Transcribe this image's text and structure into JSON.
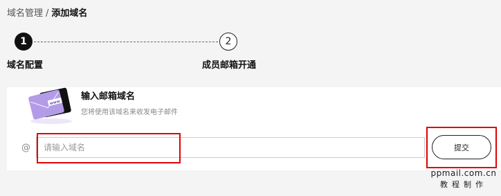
{
  "breadcrumb": {
    "parent": "域名管理",
    "separator": "/",
    "current": "添加域名"
  },
  "stepper": {
    "steps": [
      {
        "number": "1",
        "label": "域名配置",
        "state": "active"
      },
      {
        "number": "2",
        "label": "成员邮箱开通",
        "state": "pending"
      }
    ]
  },
  "card": {
    "illustration": {
      "icon": "envelope-illustration",
      "badge_text": "www"
    },
    "title": "输入邮箱域名",
    "subtitle": "您将使用该域名来收发电子邮件",
    "at_sign": "@",
    "input": {
      "placeholder": "请输入域名",
      "value": ""
    },
    "submit_label": "提交"
  },
  "watermark": {
    "line1": "ppmail.com.cn",
    "line2": "教程制作"
  },
  "colors": {
    "background": "#f4f4f4",
    "card": "#ffffff",
    "highlight": "#e00000",
    "step_active": "#111111",
    "illustration_purple": "#b39be8"
  }
}
